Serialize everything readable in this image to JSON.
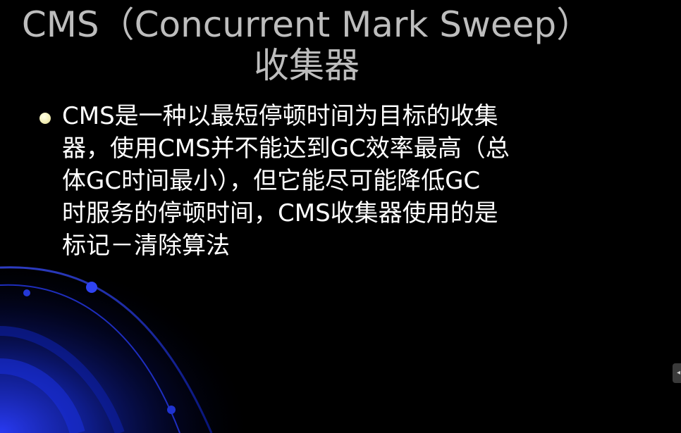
{
  "slide": {
    "title_lines": [
      "CMS（Concurrent Mark Sweep）",
      "收集器"
    ],
    "bullets": [
      {
        "lines": [
          "CMS是一种以最短停顿时间为目标的收集",
          "器，使用CMS并不能达到GC效率最高（总",
          "体GC时间最小），但它能尽可能降低GC",
          "时服务的停顿时间，CMS收集器使用的是",
          "标记－清除算法"
        ]
      }
    ]
  },
  "side_tab": {
    "icon": "arrow-handle-icon",
    "glyph": "◂"
  },
  "colors": {
    "background": "#000000",
    "title": "#bdbdbd",
    "body_text": "#ffffff",
    "bullet": "#f3efb8",
    "decor_blue": "#1f3cff"
  }
}
